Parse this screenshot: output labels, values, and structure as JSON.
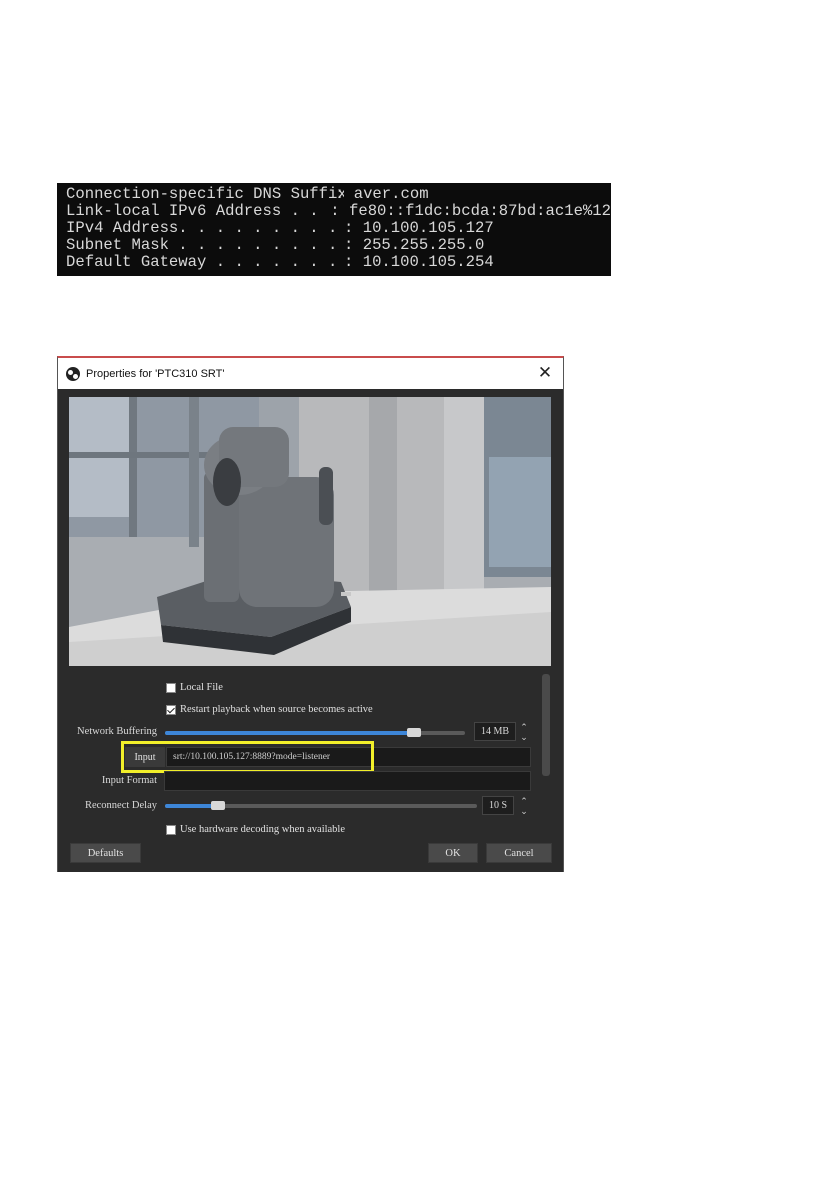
{
  "terminal": {
    "lines": [
      {
        "key": "Connection-specific DNS Suffix",
        "sep": ".",
        "value": ": aver.com"
      },
      {
        "key": "Link-local IPv6 Address . . . . .",
        "sep": "",
        "value": ": fe80::f1dc:bcda:87bd:ac1e%12"
      },
      {
        "key": "IPv4 Address. . . . . . . . . . .",
        "sep": "",
        "value": ": 10.100.105.127"
      },
      {
        "key": "Subnet Mask . . . . . . . . . . .",
        "sep": "",
        "value": ": 255.255.255.0"
      },
      {
        "key": "Default Gateway . . . . . . . . .",
        "sep": "",
        "value": ": 10.100.105.254"
      }
    ]
  },
  "dialog": {
    "title": "Properties for 'PTC310 SRT'",
    "close_glyph": "✕",
    "local_file": {
      "label": "Local File",
      "checked": false
    },
    "restart_playback": {
      "label": "Restart playback when source becomes active",
      "checked": true
    },
    "network_buffering": {
      "label": "Network Buffering",
      "value": "14 MB",
      "fraction": 0.83
    },
    "input": {
      "label": "Input",
      "value": "srt://10.100.105.127:8889?mode=listener"
    },
    "input_format": {
      "label": "Input Format",
      "value": ""
    },
    "reconnect_delay": {
      "label": "Reconnect Delay",
      "value": "10 S",
      "fraction": 0.17
    },
    "hw_decoding": {
      "label": "Use hardware decoding when available",
      "checked": false
    },
    "buttons": {
      "defaults": "Defaults",
      "ok": "OK",
      "cancel": "Cancel"
    },
    "spin_up": "⌃",
    "spin_down": "⌄"
  },
  "colors": {
    "accent": "#3d86d8",
    "highlight": "#f2ef2a",
    "dialog_bg": "#2b2b2b",
    "terminal_bg": "#0c0c0c"
  }
}
